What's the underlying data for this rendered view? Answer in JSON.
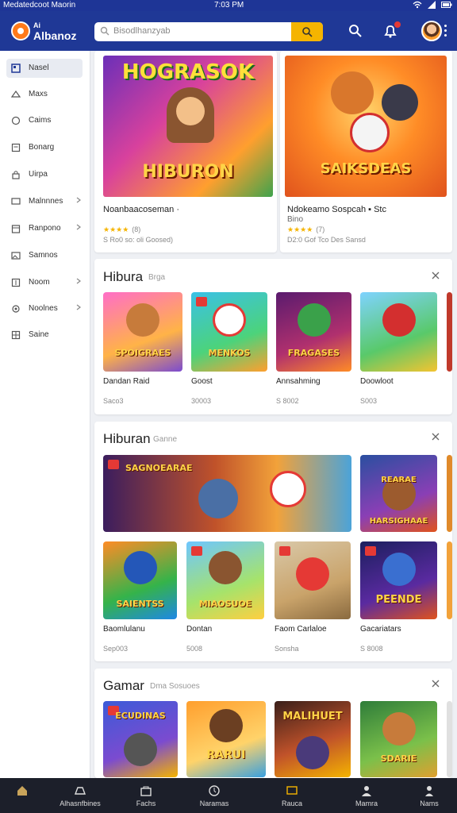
{
  "status": {
    "left": "Medatedcoot Maorin",
    "time": "7:03 PM"
  },
  "brand": {
    "line1": "Ai",
    "line2": "Albanoz"
  },
  "search": {
    "placeholder": "Bisodlhanzyab"
  },
  "sidebar": {
    "items": [
      {
        "label": "Nasel",
        "icon": "gamepad-icon",
        "active": true
      },
      {
        "label": "Maxs",
        "icon": "trophy-icon"
      },
      {
        "label": "Caims",
        "icon": "circle-icon"
      },
      {
        "label": "Bonarg",
        "icon": "box-icon"
      },
      {
        "label": "Uirpa",
        "icon": "lock-icon"
      },
      {
        "label": "Malnnnes",
        "icon": "tv-icon",
        "chevron": true
      },
      {
        "label": "Ranpono",
        "icon": "calendar-icon",
        "chevron": true
      },
      {
        "label": "Samnos",
        "icon": "image-icon"
      },
      {
        "label": "Noom",
        "icon": "square-icon",
        "chevron": true
      },
      {
        "label": "Noolnes",
        "icon": "settings-icon",
        "chevron": true
      },
      {
        "label": "Saine",
        "icon": "grid-icon"
      }
    ]
  },
  "featured": [
    {
      "img_text_top": "HOGRASOK",
      "img_text_bottom": "HIBURON",
      "title": "Noanbaacoseman ·",
      "stars": "★★★★",
      "count": "(8)",
      "meta": "S Ro0 so: oli Goosed)"
    },
    {
      "img_text_top": "",
      "img_text_bottom": "SAIKSDEAS",
      "title": "Ndokeamo Sospcah ▪ Stc",
      "sub": "Bino",
      "stars": "★★★★",
      "count": "(7)",
      "meta": "D2:0 Gof Tco Des Sansd"
    }
  ],
  "sections": [
    {
      "title": "Hibura",
      "subtitle": "Brga",
      "tiles": [
        {
          "cap": "SPOIGRAES",
          "name": "Dandan Raid",
          "sub": "Saco3"
        },
        {
          "cap": "MENKOS",
          "name": "Goost",
          "sub": "30003"
        },
        {
          "cap": "FRAGASES",
          "name": "Annsahming",
          "sub": "S 8002"
        },
        {
          "cap": "",
          "name": "Doowloot",
          "sub": "S003"
        }
      ]
    },
    {
      "title": "Hiburan",
      "subtitle": "Ganne",
      "banner": "SAGNOEARAE",
      "wide2": "REARAE HARSIGHAAE",
      "tiles": [
        {
          "cap": "SAIENTSS",
          "name": "Baomlulanu",
          "sub": "Sep003"
        },
        {
          "cap": "MIAOSUOE",
          "name": "Dontan",
          "sub": "5008"
        },
        {
          "cap": "",
          "name": "Faom Carlaloe",
          "sub": "Sonsha"
        },
        {
          "cap": "PEENDE",
          "name": "Gacariatars",
          "sub": "S 8008"
        }
      ]
    },
    {
      "title": "Gamar",
      "subtitle": "Dma Sosuoes",
      "tiles": [
        {
          "cap": "ECUDINAS"
        },
        {
          "cap": "RARUI"
        },
        {
          "cap": "MALIHUET"
        },
        {
          "cap": "SDARIE"
        }
      ]
    }
  ],
  "bottom_nav": [
    {
      "label": "",
      "icon": "home-icon"
    },
    {
      "label": "Alhasnfbines",
      "icon": "hat-icon"
    },
    {
      "label": "Fachs",
      "icon": "bag-icon"
    },
    {
      "label": "Naramas",
      "icon": "clock-icon"
    },
    {
      "label": "Rauca",
      "icon": "tv-icon"
    },
    {
      "label": "Mamra",
      "icon": "person-icon"
    },
    {
      "label": "Nams",
      "icon": "user-icon"
    }
  ]
}
